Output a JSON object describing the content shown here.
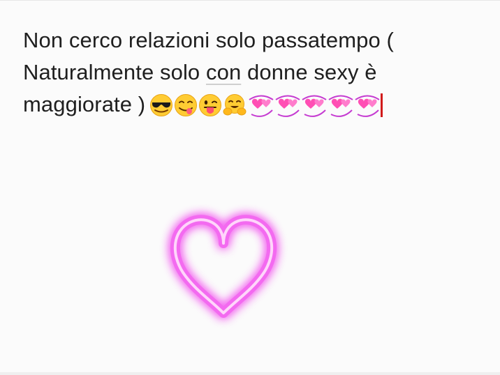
{
  "message": {
    "line1": "Non cerco relazioni solo passatempo (",
    "line2_before": "Naturalmente solo ",
    "line2_underlined": "con",
    "line2_after": " donne sexy è",
    "line3": "maggiorate  )"
  },
  "emojis": [
    {
      "name": "sunglasses-face-emoji"
    },
    {
      "name": "yum-face-emoji"
    },
    {
      "name": "tongue-wink-face-emoji"
    },
    {
      "name": "hugging-face-emoji"
    }
  ],
  "heart_count": 5,
  "colors": {
    "text": "#1f1f1f",
    "cursor": "#d11a1a",
    "heart_pink": "#ff4fb4",
    "neon_pink": "#f36bf0"
  }
}
